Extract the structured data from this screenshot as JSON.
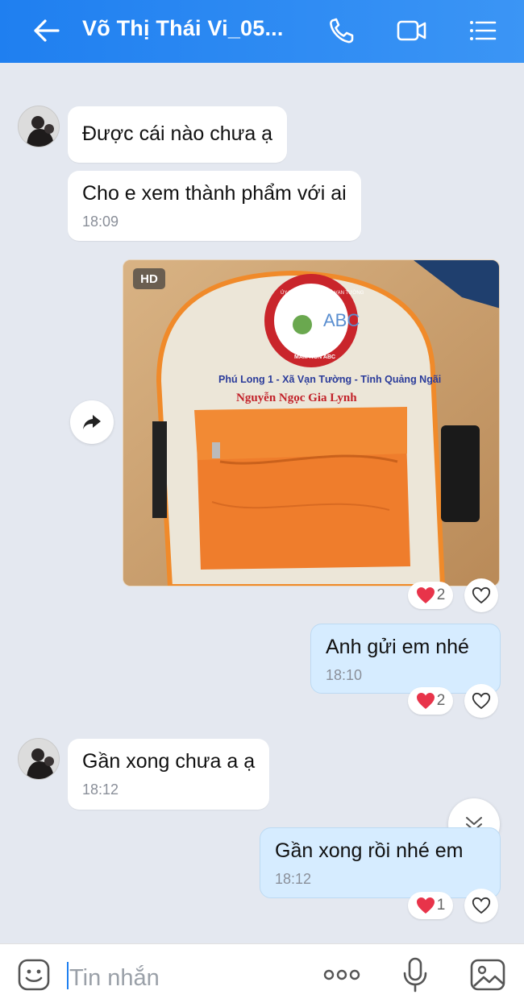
{
  "header": {
    "title": "Võ Thị Thái Vi_05...",
    "background": "#1f7ff0"
  },
  "icons": {
    "back": "arrow-left-icon",
    "call": "phone-icon",
    "video": "video-camera-icon",
    "menu": "list-menu-icon",
    "share": "forward-arrow-icon",
    "scroll": "chevron-double-down-icon",
    "sticker": "smiley-icon",
    "more": "more-dots-icon",
    "voice": "microphone-icon",
    "image": "image-icon",
    "heart": "heart-icon"
  },
  "messages": [
    {
      "id": "m1",
      "direction": "incoming",
      "text": "Được cái nào chưa ạ",
      "time": ""
    },
    {
      "id": "m2",
      "direction": "incoming",
      "text": "Cho e xem thành phẩm với ai",
      "time": "18:09"
    },
    {
      "id": "m3",
      "direction": "outgoing",
      "type": "image",
      "badge": "HD",
      "image": {
        "description_text": [
          "ỦY BAN NHÂN DÂN XÃ VẠN TƯỜNG",
          "MẦM NON ABC",
          "Phú Long 1 - Xã Vạn Tường - Tỉnh Quảng Ngãi",
          "Nguyễn Ngọc Gia Lynh"
        ]
      },
      "reaction": {
        "count": "2"
      }
    },
    {
      "id": "m4",
      "direction": "outgoing",
      "text": "Anh gửi em nhé",
      "time": "18:10",
      "reaction": {
        "count": "2"
      }
    },
    {
      "id": "m5",
      "direction": "incoming",
      "text": "Gần xong chưa a ạ",
      "time": "18:12"
    },
    {
      "id": "m6",
      "direction": "outgoing",
      "text": "Gần xong rồi nhé em",
      "time": "18:12",
      "reaction": {
        "count": "1"
      }
    }
  ],
  "input": {
    "placeholder": "Tin nhắn"
  },
  "colors": {
    "accent": "#1f7ff0",
    "chat_background": "#e4e8f0",
    "outgoing_bubble": "#d6ecff",
    "incoming_bubble": "#ffffff",
    "heart": "#e8344a"
  }
}
